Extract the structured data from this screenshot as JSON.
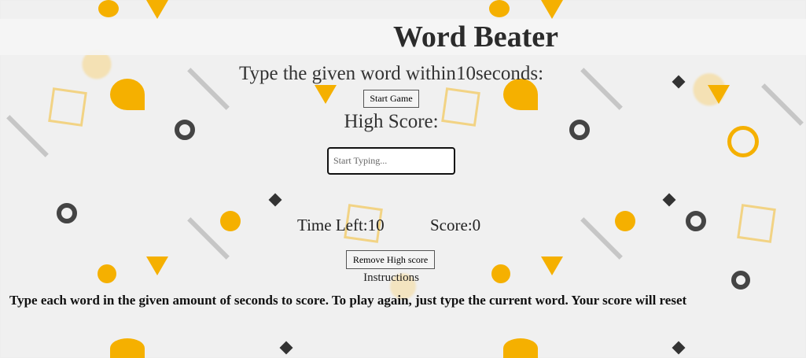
{
  "header": {
    "title": "Word Beater"
  },
  "game": {
    "prompt_prefix": "Type the given word within",
    "seconds": "10",
    "prompt_suffix": "seconds:",
    "start_button_label": "Start Game",
    "high_score_label": "High Score:",
    "high_score_value": "",
    "input_placeholder": "Start Typing...",
    "input_value": "",
    "time_left_label": "Time Left:",
    "time_left_value": "10",
    "score_label": "Score:",
    "score_value": "0",
    "remove_high_score_label": "Remove High score"
  },
  "instructions": {
    "heading": "Instructions",
    "text": "Type each word in the given amount of seconds to score. To play again, just type the current word. Your score will reset"
  },
  "colors": {
    "accent": "#f5b000",
    "dark": "#333333",
    "background": "#f0f0f0"
  }
}
